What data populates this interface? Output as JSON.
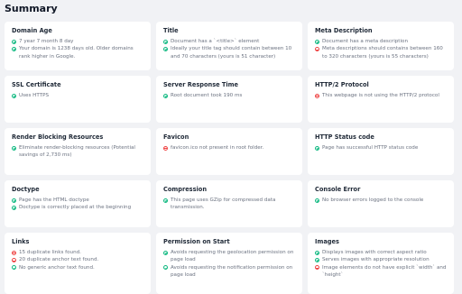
{
  "page": {
    "title": "Summary"
  },
  "colors": {
    "ok": "#10b981",
    "bad": "#ef4444"
  },
  "cards": [
    {
      "title": "Domain Age",
      "items": [
        {
          "status": "ok",
          "icon": "check-circle-icon",
          "text": "7 year 7 month 8 day"
        },
        {
          "status": "ok",
          "icon": "check-circle-icon",
          "text": "Your domain is 1238 days old. Older domains rank higher in Google."
        }
      ]
    },
    {
      "title": "Title",
      "items": [
        {
          "status": "ok",
          "icon": "check-circle-icon",
          "text": "Document has a `<title>` element"
        },
        {
          "status": "ok",
          "icon": "check-circle-icon",
          "text": "Ideally your title tag should contain between 10 and 70 characters (yours is 51 character)"
        }
      ]
    },
    {
      "title": "Meta Description",
      "items": [
        {
          "status": "ok",
          "icon": "check-circle-icon",
          "text": "Document has a meta description"
        },
        {
          "status": "bad",
          "icon": "minus-circle-icon",
          "text": "Meta descriptions should contains between 160 to 320 characters (yours is 55 characters)"
        }
      ]
    },
    {
      "title": "SSL Certificate",
      "items": [
        {
          "status": "ok",
          "icon": "check-circle-icon",
          "text": "Uses HTTPS"
        }
      ]
    },
    {
      "title": "Server Response Time",
      "items": [
        {
          "status": "ok",
          "icon": "check-circle-icon",
          "text": "Root document took 190 ms"
        }
      ]
    },
    {
      "title": "HTTP/2 Protocol",
      "items": [
        {
          "status": "bad",
          "icon": "minus-circle-icon",
          "text": "This webpage is not using the HTTP/2 protocol"
        }
      ]
    },
    {
      "title": "Render Blocking Resources",
      "items": [
        {
          "status": "ok",
          "icon": "check-circle-icon",
          "text": "Eliminate render-blocking resources (Potential savings of 2,730 ms)"
        }
      ]
    },
    {
      "title": "Favicon",
      "items": [
        {
          "status": "bad",
          "icon": "minus-circle-icon",
          "text": "favicon.ico not present in root folder."
        }
      ]
    },
    {
      "title": "HTTP Status code",
      "items": [
        {
          "status": "ok",
          "icon": "check-circle-icon",
          "text": "Page has successful HTTP status code"
        }
      ]
    },
    {
      "title": "Doctype",
      "items": [
        {
          "status": "ok",
          "icon": "check-circle-icon",
          "text": "Page has the HTML doctype"
        },
        {
          "status": "ok",
          "icon": "check-circle-icon",
          "text": "Doctype is correctly placed at the beginning"
        }
      ]
    },
    {
      "title": "Compression",
      "items": [
        {
          "status": "ok",
          "icon": "check-circle-icon",
          "text": "This page uses GZip for compressed data transmission."
        }
      ]
    },
    {
      "title": "Console Error",
      "items": [
        {
          "status": "ok",
          "icon": "check-circle-icon",
          "text": "No browser errors logged to the console"
        }
      ]
    },
    {
      "title": "Links",
      "items": [
        {
          "status": "bad",
          "icon": "minus-circle-icon",
          "text": "15 duplicate links found."
        },
        {
          "status": "bad",
          "icon": "minus-circle-icon",
          "text": "20 duplicate anchor text found."
        },
        {
          "status": "ok",
          "icon": "check-circle-icon",
          "text": "No generic anchor text found."
        }
      ]
    },
    {
      "title": "Permission on Start",
      "items": [
        {
          "status": "ok",
          "icon": "check-circle-icon",
          "text": "Avoids requesting the geolocation permission on page load"
        },
        {
          "status": "ok",
          "icon": "check-circle-icon",
          "text": "Avoids requesting the notification permission on page load"
        }
      ]
    },
    {
      "title": "Images",
      "items": [
        {
          "status": "ok",
          "icon": "check-circle-icon",
          "text": "Displays images with correct aspect ratio"
        },
        {
          "status": "ok",
          "icon": "check-circle-icon",
          "text": "Serves images with appropriate resolution"
        },
        {
          "status": "bad",
          "icon": "minus-circle-icon",
          "text": "Image elements do not have explicit `width` and `height`"
        }
      ]
    }
  ]
}
